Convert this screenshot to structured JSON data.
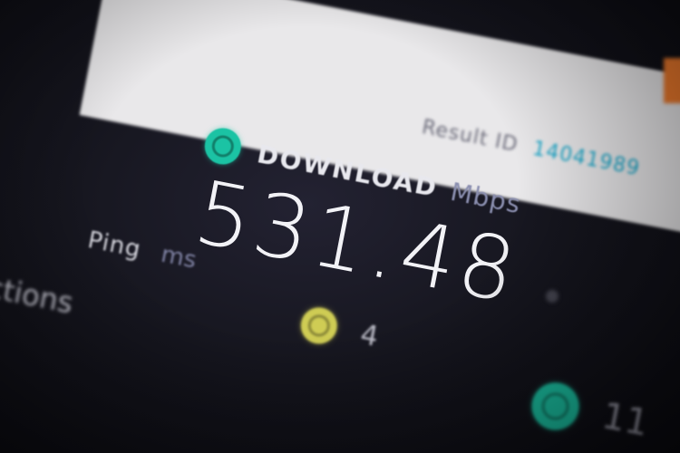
{
  "banner": {
    "text": "",
    "brand": "",
    "logo": ""
  },
  "result": {
    "label": "Result ID",
    "id": "14041989"
  },
  "download": {
    "label": "DOWNLOAD",
    "unit": "Mbps",
    "value": "531.48",
    "icon": "download-arrow-icon",
    "icon_color": "#1bc3a4"
  },
  "ping": {
    "label": "Ping",
    "unit": "ms"
  },
  "connections": {
    "label": "ctions"
  },
  "servers": {
    "icon": "servers-icon",
    "icon_color": "#cfcc54",
    "count": "4"
  },
  "upload": {
    "icon": "upload-arrow-icon",
    "icon_color": "#1bc3a4",
    "value": "11"
  },
  "colors": {
    "background": "#16161f",
    "accent_teal": "#1bc3a4",
    "accent_blue": "#1aa7c9",
    "accent_yellow": "#cfcc54"
  }
}
